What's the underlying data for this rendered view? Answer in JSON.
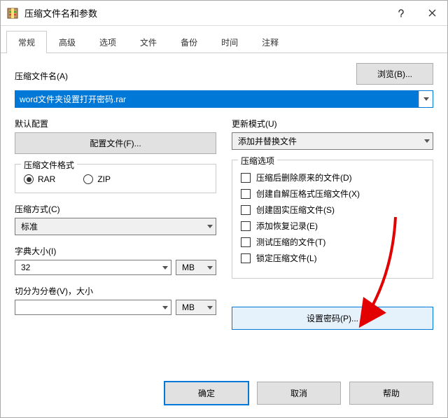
{
  "window": {
    "title": "压缩文件名和参数"
  },
  "tabs": [
    "常规",
    "高级",
    "选项",
    "文件",
    "备份",
    "时间",
    "注释"
  ],
  "filename": {
    "label": "压缩文件名(A)",
    "value": "word文件夹设置打开密码.rar",
    "browse": "浏览(B)..."
  },
  "profile": {
    "label": "默认配置",
    "button": "配置文件(F)..."
  },
  "update": {
    "label": "更新模式(U)",
    "value": "添加并替换文件"
  },
  "format": {
    "legend": "压缩文件格式",
    "rar": "RAR",
    "zip": "ZIP",
    "selected": "rar"
  },
  "options": {
    "legend": "压缩选项",
    "items": [
      "压缩后删除原来的文件(D)",
      "创建自解压格式压缩文件(X)",
      "创建固实压缩文件(S)",
      "添加恢复记录(E)",
      "测试压缩的文件(T)",
      "锁定压缩文件(L)"
    ]
  },
  "method": {
    "label": "压缩方式(C)",
    "value": "标准"
  },
  "dict": {
    "label": "字典大小(I)",
    "value": "32",
    "unit": "MB"
  },
  "split": {
    "label": "切分为分卷(V)，大小",
    "value": "",
    "unit": "MB"
  },
  "password": {
    "button": "设置密码(P)..."
  },
  "footer": {
    "ok": "确定",
    "cancel": "取消",
    "help": "帮助"
  }
}
